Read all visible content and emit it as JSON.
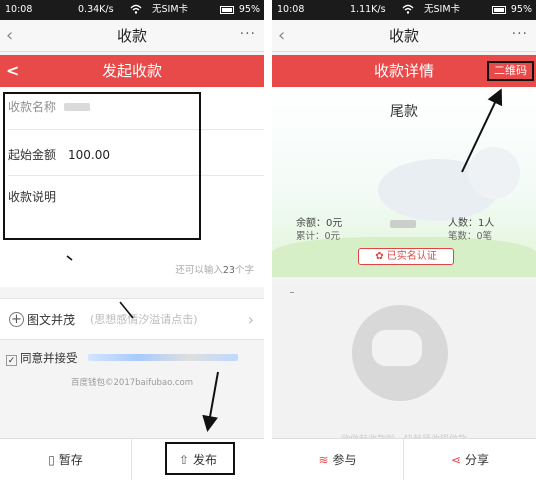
{
  "left": {
    "status": {
      "time": "10:08",
      "speed": "0.34K/s",
      "sim": "无SIM卡",
      "battery": "95%"
    },
    "nav": {
      "title": "收款",
      "more": "···"
    },
    "header": {
      "title": "发起收款"
    },
    "form": {
      "name_label": "收款名称",
      "amount_label": "起始金额",
      "amount_value": "100.00",
      "desc_label": "收款说明",
      "counter_prefix": "还可以输入",
      "counter_value": "23",
      "counter_suffix": "个字"
    },
    "extras": {
      "label": "图文并茂",
      "hint": "(思想感情汐溢请点击)"
    },
    "agree": {
      "label": "同意并接受"
    },
    "footnote": "百度钱包©2017baifubao.com",
    "bottom": {
      "save": "暂存",
      "publish": "发布"
    }
  },
  "right": {
    "status": {
      "time": "10:08",
      "speed": "1.11K/s",
      "sim": "无SIM卡",
      "battery": "95%"
    },
    "nav": {
      "title": "收款",
      "more": "···"
    },
    "header": {
      "title": "收款详情",
      "qr_button": "二维码"
    },
    "hero": {
      "title": "尾款"
    },
    "stats": {
      "balance": "余额：0元",
      "total": "累计：0元",
      "people": "人数：1人",
      "count": "笔数：0笔"
    },
    "verify_badge": "已实名认证",
    "faint_text": "欲做赶收款啦，快赶紧收银做款",
    "bottom": {
      "join": "参与",
      "share": "分享"
    }
  },
  "colors": {
    "accent": "#e84a4a",
    "statusbar": "#1b1b1b"
  }
}
